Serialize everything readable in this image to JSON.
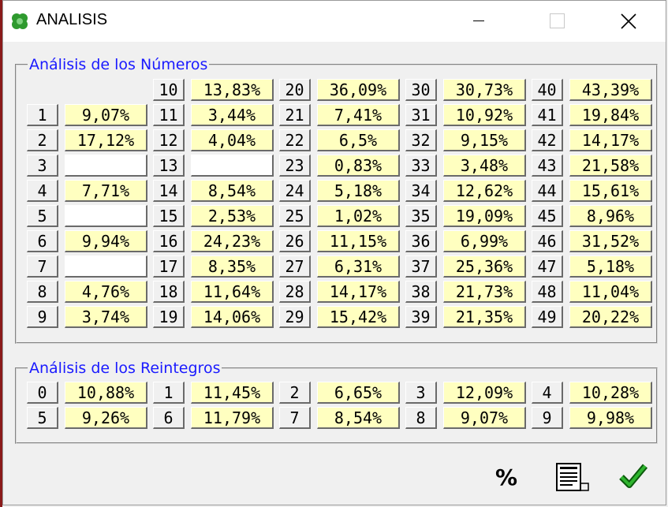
{
  "window": {
    "title": "ANALISIS"
  },
  "numbers_section": {
    "legend": "Análisis de los Números",
    "columns": [
      {
        "rows": [
          {
            "n": "1",
            "p": "9,07%"
          },
          {
            "n": "2",
            "p": "17,12%"
          },
          {
            "n": "3",
            "p": ""
          },
          {
            "n": "4",
            "p": "7,71%"
          },
          {
            "n": "5",
            "p": ""
          },
          {
            "n": "6",
            "p": "9,94%"
          },
          {
            "n": "7",
            "p": ""
          },
          {
            "n": "8",
            "p": "4,76%"
          },
          {
            "n": "9",
            "p": "3,74%"
          }
        ]
      },
      {
        "rows": [
          {
            "n": "10",
            "p": "13,83%"
          },
          {
            "n": "11",
            "p": "3,44%"
          },
          {
            "n": "12",
            "p": "4,04%"
          },
          {
            "n": "13",
            "p": ""
          },
          {
            "n": "14",
            "p": "8,54%"
          },
          {
            "n": "15",
            "p": "2,53%"
          },
          {
            "n": "16",
            "p": "24,23%"
          },
          {
            "n": "17",
            "p": "8,35%"
          },
          {
            "n": "18",
            "p": "11,64%"
          },
          {
            "n": "19",
            "p": "14,06%"
          }
        ]
      },
      {
        "rows": [
          {
            "n": "20",
            "p": "36,09%"
          },
          {
            "n": "21",
            "p": "7,41%"
          },
          {
            "n": "22",
            "p": "6,5%"
          },
          {
            "n": "23",
            "p": "0,83%"
          },
          {
            "n": "24",
            "p": "5,18%"
          },
          {
            "n": "25",
            "p": "1,02%"
          },
          {
            "n": "26",
            "p": "11,15%"
          },
          {
            "n": "27",
            "p": "6,31%"
          },
          {
            "n": "28",
            "p": "14,17%"
          },
          {
            "n": "29",
            "p": "15,42%"
          }
        ]
      },
      {
        "rows": [
          {
            "n": "30",
            "p": "30,73%"
          },
          {
            "n": "31",
            "p": "10,92%"
          },
          {
            "n": "32",
            "p": "9,15%"
          },
          {
            "n": "33",
            "p": "3,48%"
          },
          {
            "n": "34",
            "p": "12,62%"
          },
          {
            "n": "35",
            "p": "19,09%"
          },
          {
            "n": "36",
            "p": "6,99%"
          },
          {
            "n": "37",
            "p": "25,36%"
          },
          {
            "n": "38",
            "p": "21,73%"
          },
          {
            "n": "39",
            "p": "21,35%"
          }
        ]
      },
      {
        "rows": [
          {
            "n": "40",
            "p": "43,39%"
          },
          {
            "n": "41",
            "p": "19,84%"
          },
          {
            "n": "42",
            "p": "14,17%"
          },
          {
            "n": "43",
            "p": "21,58%"
          },
          {
            "n": "44",
            "p": "15,61%"
          },
          {
            "n": "45",
            "p": "8,96%"
          },
          {
            "n": "46",
            "p": "31,52%"
          },
          {
            "n": "47",
            "p": "5,18%"
          },
          {
            "n": "48",
            "p": "11,04%"
          },
          {
            "n": "49",
            "p": "20,22%"
          }
        ]
      }
    ]
  },
  "reintegros_section": {
    "legend": "Análisis de los Reintegros",
    "rows": [
      [
        {
          "n": "0",
          "p": "10,88%"
        },
        {
          "n": "1",
          "p": "11,45%"
        },
        {
          "n": "2",
          "p": "6,65%"
        },
        {
          "n": "3",
          "p": "12,09%"
        },
        {
          "n": "4",
          "p": "10,28%"
        }
      ],
      [
        {
          "n": "5",
          "p": "9,26%"
        },
        {
          "n": "6",
          "p": "11,79%"
        },
        {
          "n": "7",
          "p": "8,54%"
        },
        {
          "n": "8",
          "p": "9,07%"
        },
        {
          "n": "9",
          "p": "9,98%"
        }
      ]
    ]
  },
  "toolbar": {
    "percent_label": "%",
    "icons": [
      "percent-icon",
      "report-icon",
      "checkmark-icon"
    ]
  },
  "colors": {
    "legend": "#1a1aff",
    "value_cell": "#ffffc0",
    "empty_cell": "#ffffff",
    "check": "#1a8a1a"
  }
}
